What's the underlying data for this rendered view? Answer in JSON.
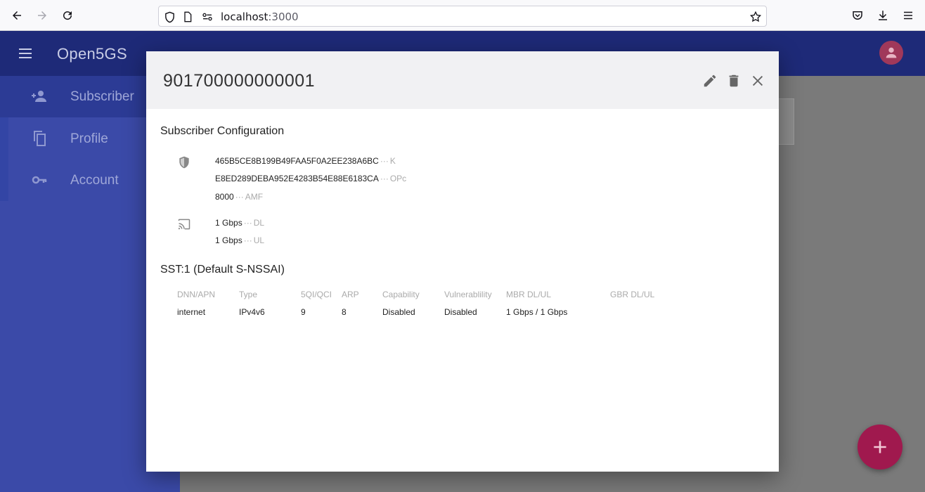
{
  "browser": {
    "url_host": "localhost",
    "url_port": ":3000"
  },
  "app": {
    "title": "Open5GS"
  },
  "sidebar": {
    "items": [
      {
        "label": "Subscriber",
        "icon": "person-add-icon",
        "active": true
      },
      {
        "label": "Profile",
        "icon": "copy-icon",
        "active": false
      },
      {
        "label": "Account",
        "icon": "key-icon",
        "active": false
      }
    ]
  },
  "modal": {
    "title": "901700000000001",
    "section_config": "Subscriber Configuration",
    "security": [
      {
        "value": "465B5CE8B199B49FAA5F0A2EE238A6BC",
        "key": "K"
      },
      {
        "value": "E8ED289DEBA952E4283B54E88E6183CA",
        "key": "OPc"
      },
      {
        "value": "8000",
        "key": "AMF"
      }
    ],
    "ambr": [
      {
        "value": "1 Gbps",
        "key": "DL"
      },
      {
        "value": "1 Gbps",
        "key": "UL"
      }
    ],
    "dots": "···",
    "section_slice": "SST:1 (Default S-NSSAI)",
    "table": {
      "headers": [
        "DNN/APN",
        "Type",
        "5QI/QCI",
        "ARP",
        "Capability",
        "Vulnerablility",
        "MBR DL/UL",
        "GBR DL/UL"
      ],
      "rows": [
        [
          "internet",
          "IPv4v6",
          "9",
          "8",
          "Disabled",
          "Disabled",
          "1 Gbps / 1 Gbps",
          ""
        ]
      ]
    }
  },
  "colors": {
    "appbar": "#1e2a78",
    "sidebar": "#3b4aa8",
    "fab": "#a0194e",
    "avatar": "#a0385a"
  }
}
